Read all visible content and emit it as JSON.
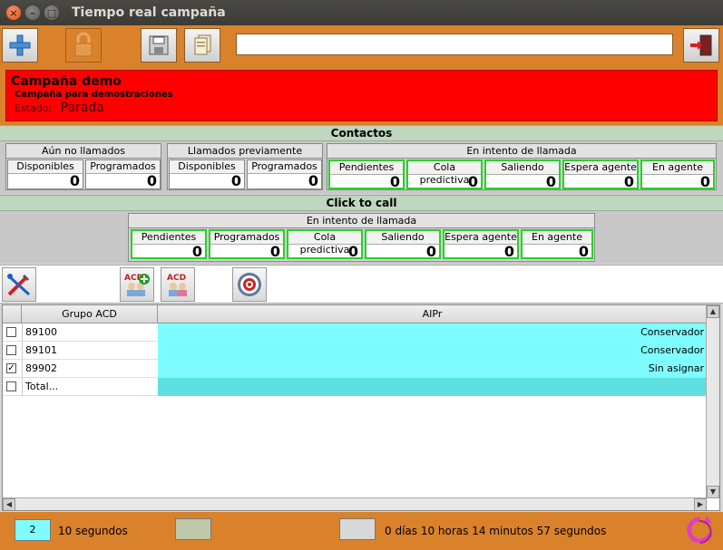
{
  "window": {
    "title": "Tiempo real campaña"
  },
  "toolbar": {
    "buttons": [
      {
        "icon": "plus-icon"
      },
      {
        "icon": "lock-icon",
        "disabled": true
      },
      {
        "icon": "save-icon"
      },
      {
        "icon": "files-icon"
      }
    ],
    "input_value": "",
    "exit_icon": "exit-door-icon"
  },
  "campaign": {
    "name": "Campaña demo",
    "description": "Campaña para demostraciones",
    "estado_label": "Estado:",
    "estado_value": "Parada",
    "color": "#ff0000"
  },
  "contactos": {
    "title": "Contactos",
    "groups": [
      {
        "title": "Aún no llamados",
        "cells": [
          {
            "label": "Disponibles",
            "value": "0"
          },
          {
            "label": "Programados",
            "value": "0"
          }
        ]
      },
      {
        "title": "Llamados previamente",
        "cells": [
          {
            "label": "Disponibles",
            "value": "0"
          },
          {
            "label": "Programados",
            "value": "0"
          }
        ]
      },
      {
        "title": "En intento de llamada",
        "cells": [
          {
            "label": "Pendientes",
            "value": "0"
          },
          {
            "label": "Cola predictiva",
            "value": "0"
          },
          {
            "label": "Saliendo",
            "value": "0"
          },
          {
            "label": "Espera agente",
            "value": "0"
          },
          {
            "label": "En agente",
            "value": "0"
          }
        ]
      }
    ]
  },
  "click_to_call": {
    "title": "Click to call",
    "group_title": "En intento de llamada",
    "cells": [
      {
        "label": "Pendientes",
        "value": "0"
      },
      {
        "label": "Programados",
        "value": "0"
      },
      {
        "label": "Cola predictiva",
        "value": "0"
      },
      {
        "label": "Saliendo",
        "value": "0"
      },
      {
        "label": "Espera agente",
        "value": "0"
      },
      {
        "label": "En agente",
        "value": "0"
      }
    ]
  },
  "actions": {
    "buttons": [
      {
        "icon": "tools-icon"
      },
      {
        "icon": "acd-add-icon",
        "text": "ACD"
      },
      {
        "icon": "acd-icon",
        "text": "ACD"
      },
      {
        "icon": "target-icon"
      }
    ]
  },
  "table": {
    "columns": [
      "Grupo ACD",
      "AIPr"
    ],
    "rows": [
      {
        "checked": false,
        "grupo": "89100",
        "aipr": "Conservador"
      },
      {
        "checked": false,
        "grupo": "89101",
        "aipr": "Conservador"
      },
      {
        "checked": true,
        "grupo": "89902",
        "aipr": "Sin asignar"
      },
      {
        "checked": false,
        "grupo": "Total...",
        "aipr": ""
      }
    ]
  },
  "status": {
    "refresh_value": "2",
    "refresh_unit": "10 segundos",
    "elapsed": "0 días 10 horas 14 minutos 57 segundos"
  },
  "colors": {
    "accent": "#d9822b",
    "section": "#bfd6bf",
    "cyan": "#7ffcff",
    "green_border": "#2ad02a"
  }
}
